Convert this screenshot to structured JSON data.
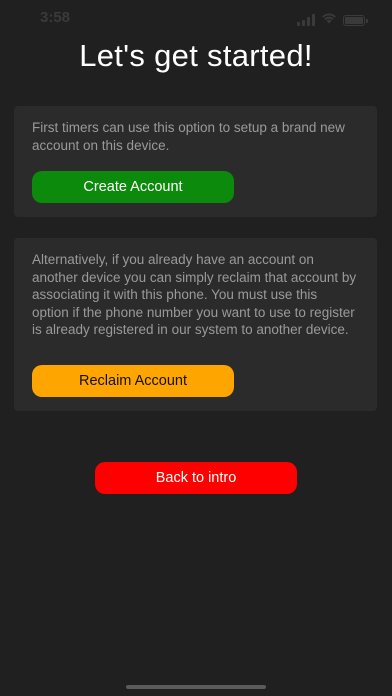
{
  "status_bar": {
    "time": "3:58",
    "icons": [
      "signal-icon",
      "wifi-icon",
      "battery-icon"
    ]
  },
  "title": "Let's get started!",
  "create_section": {
    "description": "First timers can use this option to setup a brand new account on this device.",
    "button_label": "Create Account",
    "button_color": "#0c8a0c"
  },
  "reclaim_section": {
    "description": "Alternatively, if you already have an account on another device you can simply reclaim that account by associating it with this phone.  You must use this option if the phone number you want to use to register is already registered in our system to another device.",
    "button_label": "Reclaim Account",
    "button_color": "#ffa500"
  },
  "back_button": {
    "label": "Back to intro",
    "color": "#ff0000"
  },
  "colors": {
    "background": "#202020",
    "card": "#2b2b2b",
    "description_text": "#9a9a9a"
  }
}
